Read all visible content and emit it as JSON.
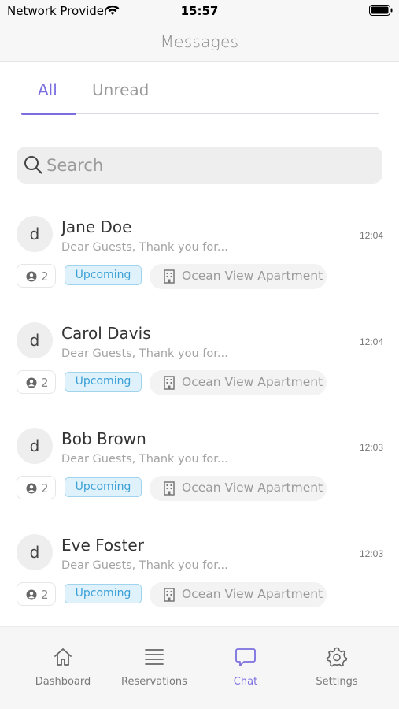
{
  "status_bar": {
    "carrier": "Network Provider",
    "time": "15:57"
  },
  "header": {
    "title": "Messages"
  },
  "tabs": [
    {
      "label": "All",
      "active": true
    },
    {
      "label": "Unread",
      "active": false
    }
  ],
  "search": {
    "placeholder": "Search",
    "value": ""
  },
  "conversations": [
    {
      "initial": "d",
      "name": "Jane Doe",
      "preview": "Dear Guests, Thank you for...",
      "time": "12:04",
      "guests": "2",
      "status": "Upcoming",
      "property": "Ocean View Apartment"
    },
    {
      "initial": "d",
      "name": "Carol Davis",
      "preview": "Dear Guests, Thank you for...",
      "time": "12:04",
      "guests": "2",
      "status": "Upcoming",
      "property": "Ocean View Apartment"
    },
    {
      "initial": "d",
      "name": "Bob Brown",
      "preview": "Dear Guests, Thank you for...",
      "time": "12:03",
      "guests": "2",
      "status": "Upcoming",
      "property": "Ocean View Apartment"
    },
    {
      "initial": "d",
      "name": "Eve Foster",
      "preview": "Dear Guests, Thank you for...",
      "time": "12:03",
      "guests": "2",
      "status": "Upcoming",
      "property": "Ocean View Apartment"
    }
  ],
  "tab_bar": [
    {
      "label": "Dashboard",
      "icon": "home-icon",
      "active": false
    },
    {
      "label": "Reservations",
      "icon": "list-icon",
      "active": false
    },
    {
      "label": "Chat",
      "icon": "chat-icon",
      "active": true
    },
    {
      "label": "Settings",
      "icon": "gear-icon",
      "active": false
    }
  ],
  "colors": {
    "accent": "#7b6fe0",
    "status_badge_bg": "#dff1fb",
    "status_badge_text": "#3aa0d6"
  }
}
